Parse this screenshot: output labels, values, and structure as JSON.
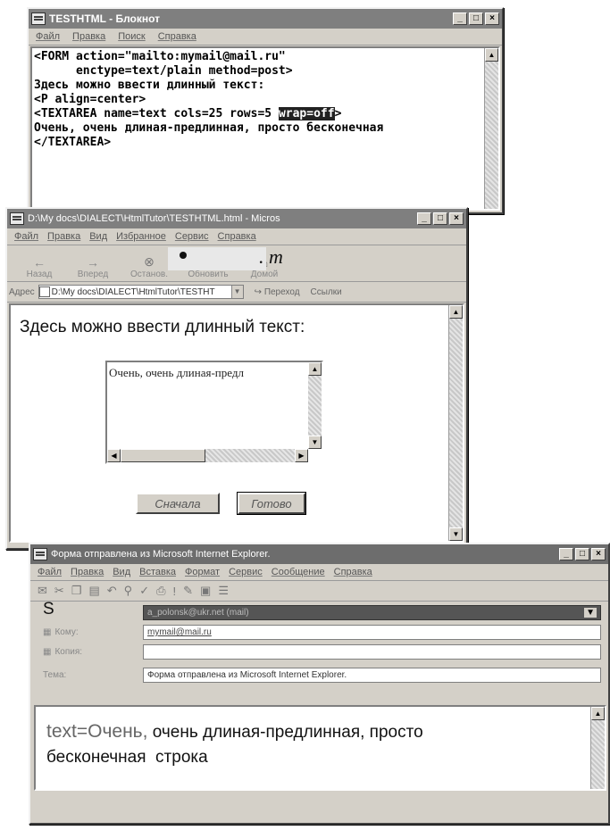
{
  "notepad": {
    "title": "TESTHTML - Блокнот",
    "menu": [
      "Файл",
      "Правка",
      "Поиск",
      "Справка"
    ],
    "lines": [
      {
        "text": "<FORM action=\"mailto:mymail@mail.ru\""
      },
      {
        "text": "      enctype=text/plain method=post>"
      },
      {
        "text": ""
      },
      {
        "text": "Здесь можно ввести длинный текст:"
      },
      {
        "text": "<P align=center>"
      },
      {
        "pre": "<TEXTAREA name=text cols=25 rows=5 ",
        "hl": "wrap=off",
        "post": ">"
      },
      {
        "text": "Очень, очень длиная-предлинная, просто бесконечная"
      },
      {
        "text": "</TEXTAREA>"
      }
    ]
  },
  "browser": {
    "title": "D:\\My docs\\DIALECT\\HtmlTutor\\TESTHTML.html - Micros",
    "menu": [
      "Файл",
      "Правка",
      "Вид",
      "Избранное",
      "Сервис",
      "Справка"
    ],
    "toolbar": [
      {
        "label": "Назад",
        "icon": "back-arrow-icon"
      },
      {
        "label": "Вперед",
        "icon": "forward-arrow-icon"
      },
      {
        "label": "Останов.",
        "icon": "stop-icon"
      },
      {
        "label": "Обновить",
        "icon": "refresh-icon"
      },
      {
        "label": "Домой",
        "icon": "home-icon"
      }
    ],
    "overlay_text": ". m",
    "address_label": "Адрес",
    "address_value": "D:\\My docs\\DIALECT\\HtmlTutor\\TESTHT",
    "go_label": "Переход",
    "links_label": "Ссылки",
    "page_text": "Здесь можно ввести длинный текст:",
    "textarea_value": "Очень, очень длиная-предл",
    "reset_button": "Сначала",
    "submit_button": "Готово"
  },
  "email": {
    "title": "Форма отправлена из Microsoft Internet Explorer.",
    "menu": [
      "Файл",
      "Правка",
      "Вид",
      "Вставка",
      "Формат",
      "Сервис",
      "Сообщение",
      "Справка"
    ],
    "from_label": "S",
    "from_value": "a_polonsk@ukr.net   (mail)",
    "to_label": "Кому:",
    "to_value": "mymail@mail.ru",
    "cc_label": "Копия:",
    "cc_value": "",
    "subject_label": "Тема:",
    "subject_value": "Форма отправлена из Microsoft Internet Explorer.",
    "body_prefix": "text=Очень,",
    "body_rest": "очень длиная-предлинная, просто",
    "body_line2": "бесконечная  строка"
  },
  "colors": {
    "window_face": "#d4d0c8",
    "inactive_title": "#7f7f7f",
    "highlight": "#222222"
  }
}
